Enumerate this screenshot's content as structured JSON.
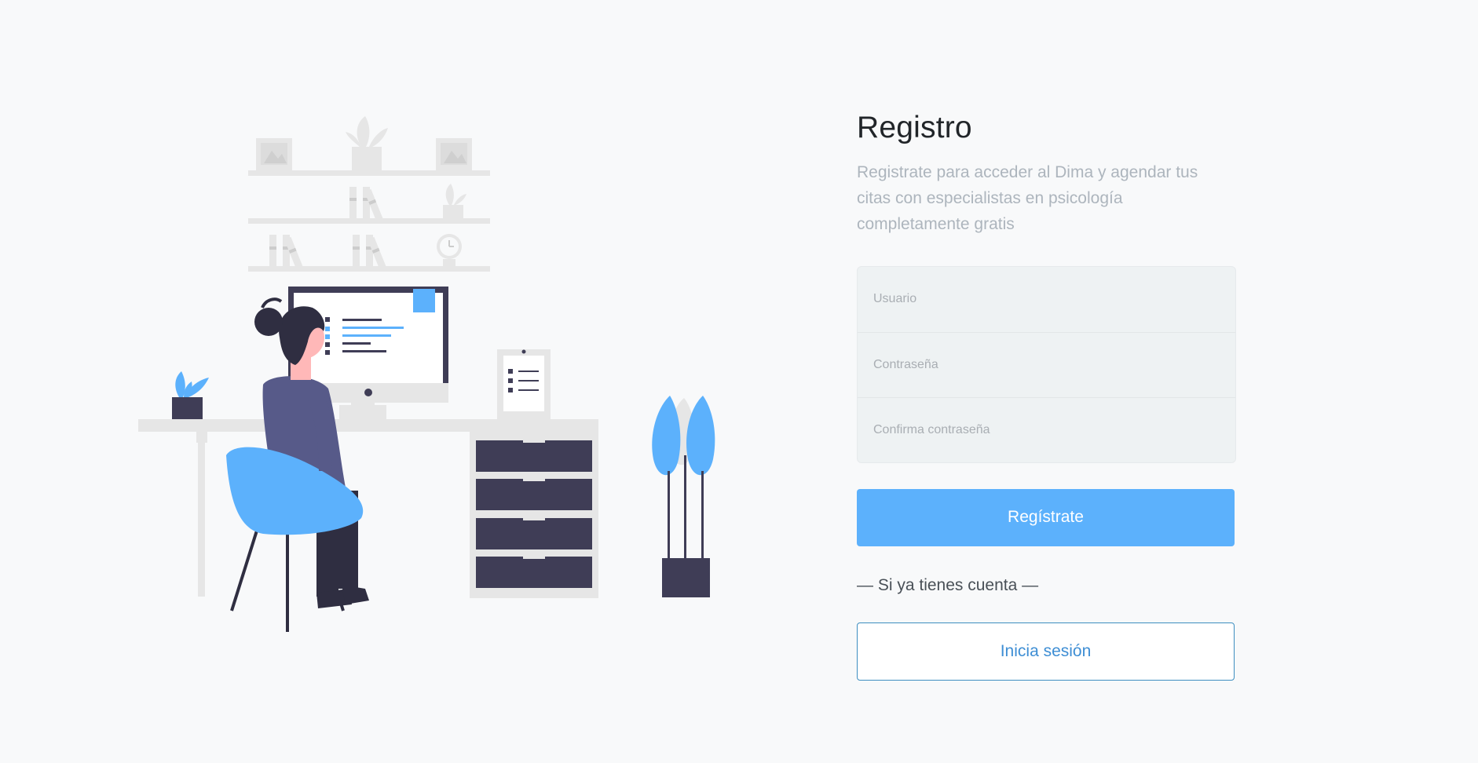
{
  "register": {
    "title": "Registro",
    "subtitle": "Registrate para acceder al Dima y agendar tus citas con especialistas en psicología completamente gratis",
    "fields": {
      "username_placeholder": "Usuario",
      "password_placeholder": "Contraseña",
      "confirm_placeholder": "Confirma contraseña"
    },
    "submit_label": "Regístrate",
    "divider": "— Si ya tienes cuenta —",
    "login_label": "Inicia sesión"
  },
  "colors": {
    "primary": "#5cb1fc",
    "outline_border": "#3d8ec0",
    "outline_text": "#3e8ed4",
    "background": "#f8f9fa",
    "illustration_dark": "#3f3d56",
    "illustration_light": "#e6e6e6"
  },
  "illustration": {
    "name": "person-working-at-desk-illustration"
  }
}
